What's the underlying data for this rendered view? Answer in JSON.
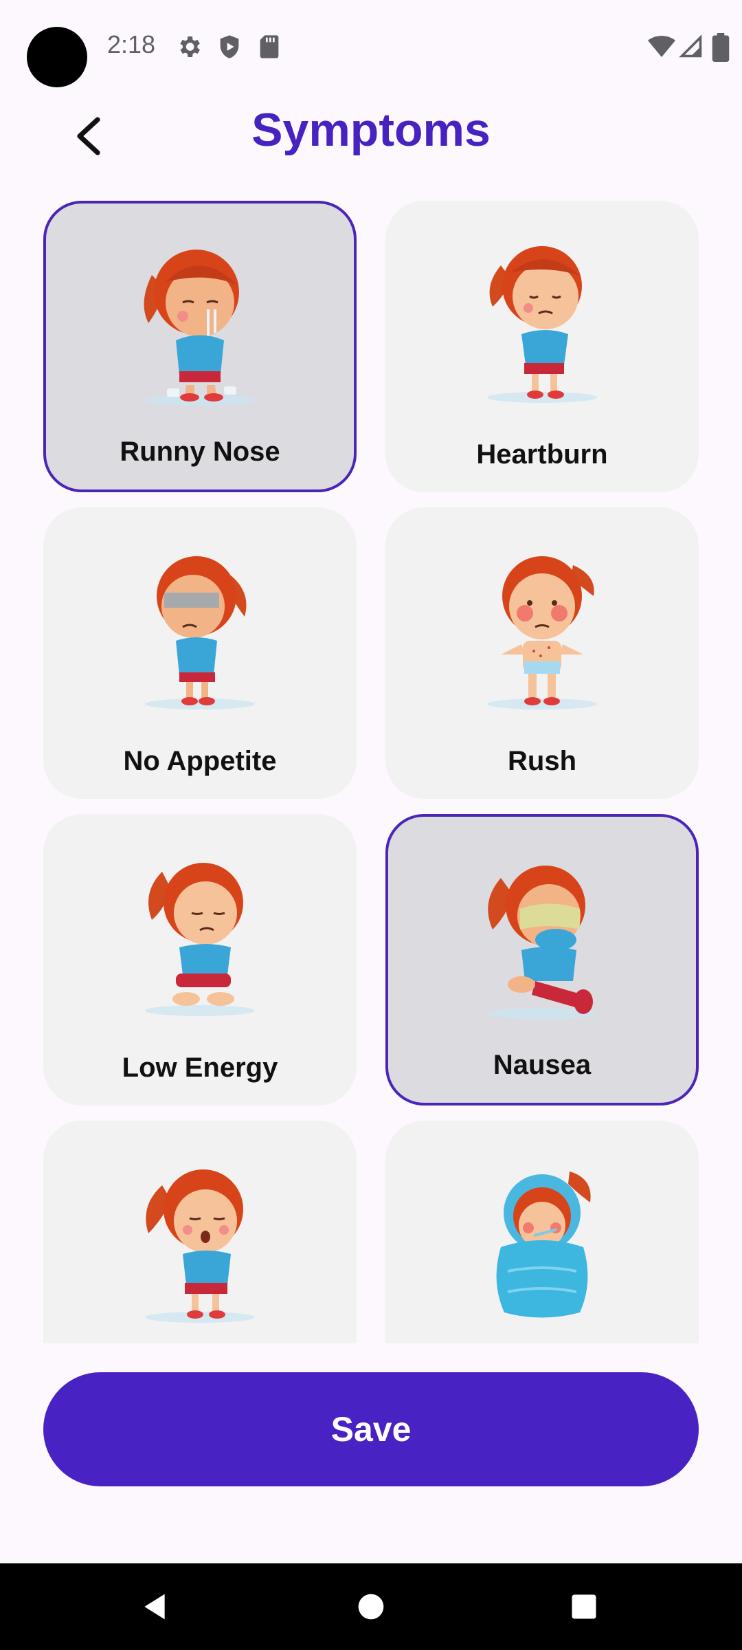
{
  "status_bar": {
    "time": "2:18",
    "icons_left": [
      "gear-icon",
      "shield-play-icon",
      "sd-card-icon"
    ],
    "icons_right": [
      "wifi-icon",
      "signal-icon",
      "battery-icon"
    ]
  },
  "header": {
    "title": "Symptoms",
    "back_icon": "chevron-left-icon"
  },
  "colors": {
    "accent": "#4622c0",
    "card_bg": "#f2f2f2",
    "card_selected_bg": "#dcdbdf",
    "card_selected_border": "#4b25b8",
    "page_bg": "#fdf8fd"
  },
  "symptoms": [
    {
      "label": "Runny Nose",
      "selected": true,
      "illustration": "girl-runny-nose-illustration"
    },
    {
      "label": "Heartburn",
      "selected": false,
      "illustration": "girl-heartburn-illustration"
    },
    {
      "label": "No Appetite",
      "selected": false,
      "illustration": "girl-no-appetite-illustration"
    },
    {
      "label": "Rush",
      "selected": false,
      "illustration": "girl-rash-illustration"
    },
    {
      "label": "Low Energy",
      "selected": false,
      "illustration": "girl-low-energy-illustration"
    },
    {
      "label": "Nausea",
      "selected": true,
      "illustration": "girl-nausea-illustration"
    },
    {
      "label": "",
      "selected": false,
      "illustration": "girl-cough-illustration"
    },
    {
      "label": "",
      "selected": false,
      "illustration": "girl-fever-blanket-illustration"
    }
  ],
  "save_label": "Save",
  "nav": [
    "back-triangle-icon",
    "home-circle-icon",
    "recents-square-icon"
  ]
}
